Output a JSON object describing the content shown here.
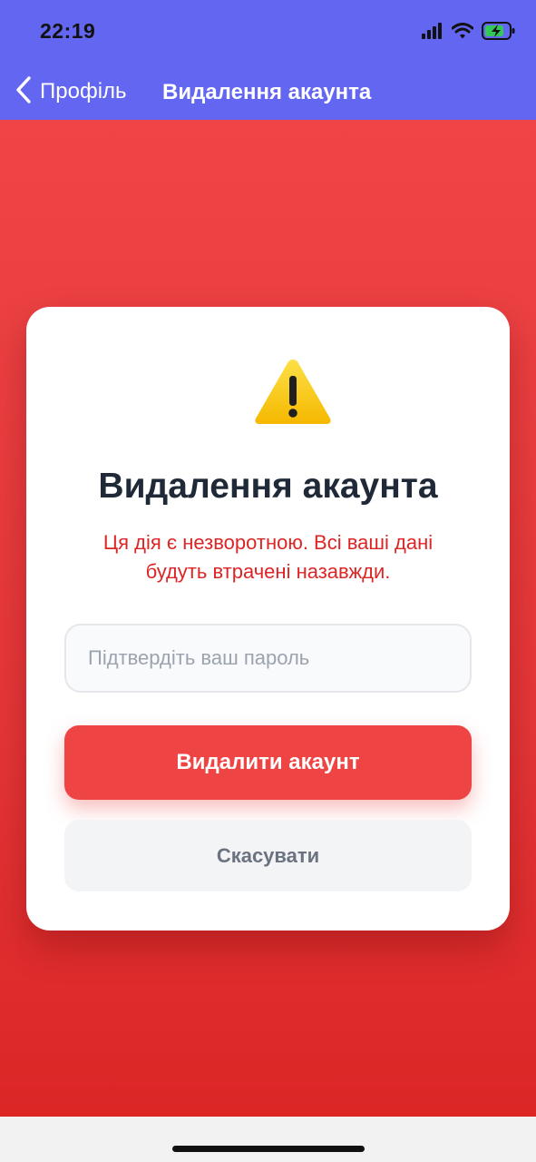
{
  "status_bar": {
    "time": "22:19",
    "icons": [
      "cellular-signal-icon",
      "wifi-icon",
      "battery-charging-icon"
    ]
  },
  "nav": {
    "back_label": "Профіль",
    "title": "Видалення акаунта"
  },
  "card": {
    "icon": "warning-icon",
    "title": "Видалення акаунта",
    "warning_line1": "Ця дія є незворотною. Всі ваші дані",
    "warning_line2": "будуть втрачені назавжди.",
    "password_value": "",
    "password_placeholder": "Підтвердіть ваш пароль",
    "delete_label": "Видалити акаунт",
    "cancel_label": "Скасувати"
  },
  "colors": {
    "header": "#6366f1",
    "danger": "#ef4444",
    "danger_text": "#dc2626",
    "title_text": "#1f2937",
    "cancel_bg": "#f3f4f6",
    "warning_yellow": "#fbbf24"
  }
}
